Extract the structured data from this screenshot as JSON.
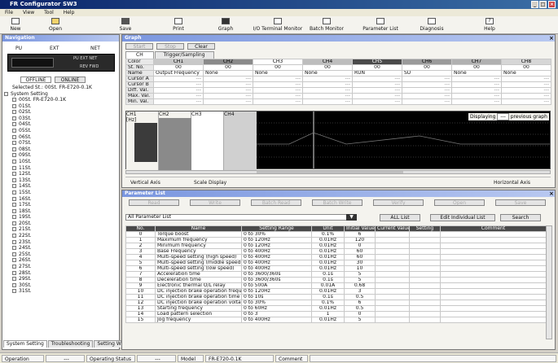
{
  "app": {
    "title": "FR Configurator SW3"
  },
  "menu": [
    "File",
    "View",
    "Tool",
    "Help"
  ],
  "toolbar": [
    "New",
    "Open",
    "Save",
    "Print",
    "Graph",
    "I/O Terminal Monitor",
    "Batch Monitor",
    "Parameter List",
    "Diagnosis",
    "Help"
  ],
  "nav": {
    "title": "Navigation",
    "modes": [
      "PU",
      "EXT",
      "NET"
    ],
    "pu_label": "PU EXT NET",
    "rev_fwd": "REV  FWD",
    "offline": "OFFLINE",
    "online": "ONLINE",
    "selected": "Selected St.: 00St. FR-E720-0.1K",
    "tree_root": "System Setting",
    "stations": [
      "00St. FR-E720-0.1K",
      "01St.",
      "02St.",
      "03St.",
      "04St.",
      "05St.",
      "06St.",
      "07St.",
      "08St.",
      "09St.",
      "10St.",
      "11St.",
      "12St.",
      "13St.",
      "14St.",
      "15St.",
      "16St.",
      "17St.",
      "18St.",
      "19St.",
      "20St.",
      "21St.",
      "22St.",
      "23St.",
      "24St.",
      "25St.",
      "26St.",
      "27St.",
      "28St.",
      "29St.",
      "30St.",
      "31St."
    ],
    "tabs": [
      "System Setting",
      "Troubleshooting",
      "Setting Wizard"
    ]
  },
  "graph": {
    "title": "Graph",
    "buttons": [
      "Start",
      "Stop",
      "Clear"
    ],
    "tabs": [
      "CH",
      "Trigger/Sampling"
    ],
    "row_labels": [
      "Color",
      "St. No.",
      "Name",
      "Cursor A",
      "Cursor B",
      "Diff. Val.",
      "Max. Val.",
      "Min. Val."
    ],
    "channels": [
      {
        "ch": "CH1",
        "stno": "00",
        "name": "Output Frequency",
        "color": "#c8c8c8"
      },
      {
        "ch": "CH2",
        "stno": "00",
        "name": "None",
        "color": "#8a8a8a"
      },
      {
        "ch": "CH3",
        "stno": "00",
        "name": "None",
        "color": "#ffffff"
      },
      {
        "ch": "CH4",
        "stno": "00",
        "name": "None",
        "color": "#bdbdbd"
      },
      {
        "ch": "CH5",
        "stno": "00",
        "name": "RUN",
        "color": "#4a4a4a"
      },
      {
        "ch": "CH6",
        "stno": "00",
        "name": "SU",
        "color": "#9a9a9a"
      },
      {
        "ch": "CH7",
        "stno": "00",
        "name": "None",
        "color": "#b0b0b0"
      },
      {
        "ch": "CH8",
        "stno": "00",
        "name": "None",
        "color": "#d6d6d6"
      }
    ],
    "dash": "---",
    "lower_labels": [
      "CH1",
      "CH2",
      "CH3",
      "CH4"
    ],
    "unit": "[Hz]",
    "displaying": "Displaying",
    "prev_graph": "previous graph",
    "vertical_axis": "Vertical Axis",
    "scale_display": "Scale Display",
    "horizontal_axis": "Horizontal Axis"
  },
  "params": {
    "title": "Parameter List",
    "top_buttons": [
      "Read",
      "Write",
      "Batch Read",
      "Batch Write",
      "Verify",
      "Open",
      "Save"
    ],
    "list_select": "All Parameter List",
    "all_list": "ALL List",
    "edit_list": "Edit Individual List",
    "search": "Search",
    "columns": [
      "No.",
      "Name",
      "Setting Range",
      "Unit",
      "Initial Value",
      "Current Value",
      "Setting",
      "Comment"
    ],
    "rows": [
      [
        "0",
        "Torque boost",
        "0 to 30%",
        "0.1%",
        "6"
      ],
      [
        "1",
        "Maximum frequency",
        "0 to 120Hz",
        "0.01Hz",
        "120"
      ],
      [
        "2",
        "Minimum frequency",
        "0 to 120Hz",
        "0.01Hz",
        "0"
      ],
      [
        "3",
        "Base Frequency",
        "0 to 400Hz",
        "0.01Hz",
        "60"
      ],
      [
        "4",
        "Multi-speed setting (high speed)",
        "0 to 400Hz",
        "0.01Hz",
        "60"
      ],
      [
        "5",
        "Multi-speed setting (middle speed)",
        "0 to 400Hz",
        "0.01Hz",
        "30"
      ],
      [
        "6",
        "Multi-speed setting (low speed)",
        "0 to 400Hz",
        "0.01Hz",
        "10"
      ],
      [
        "7",
        "Acceleration time",
        "0 to 3600/360s",
        "0.1s",
        "5"
      ],
      [
        "8",
        "Deceleration time",
        "0 to 3600/360s",
        "0.1s",
        "5"
      ],
      [
        "9",
        "Electronic thermal O/L relay",
        "0 to 500A",
        "0.01A",
        "0.68"
      ],
      [
        "10",
        "DC injection brake operation frequency",
        "0 to 120Hz",
        "0.01Hz",
        "3"
      ],
      [
        "11",
        "DC injection brake operation time",
        "0 to 10s",
        "0.1s",
        "0.5"
      ],
      [
        "12",
        "DC injection brake operation voltage",
        "0 to 30%",
        "0.1%",
        "6"
      ],
      [
        "13",
        "Starting frequency",
        "0 to 60Hz",
        "0.01Hz",
        "0.5"
      ],
      [
        "14",
        "Load pattern selection",
        "0 to 3",
        "1",
        "0"
      ],
      [
        "15",
        "Jog frequency",
        "0 to 400Hz",
        "0.01Hz",
        "5"
      ]
    ]
  },
  "status": {
    "op_mode": "Operation Mode",
    "op_mode_val": "---",
    "op_status": "Operating Status",
    "op_status_val": "---",
    "model": "Model",
    "model_val": "FR-E720-0.1K",
    "comment": "Comment"
  }
}
